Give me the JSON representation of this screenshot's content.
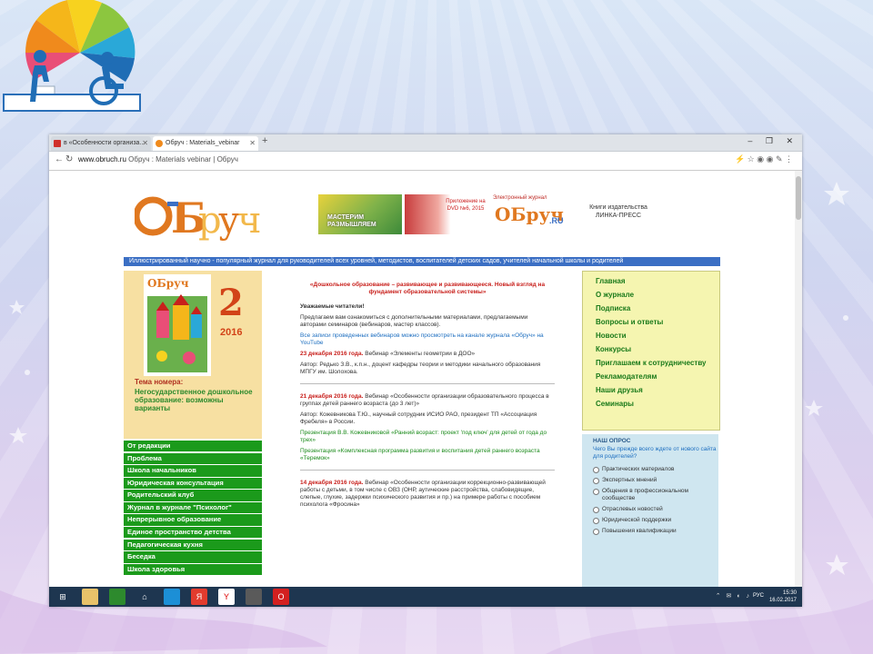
{
  "browser": {
    "tabs": [
      {
        "label": "в «Особенности организа...",
        "favicon": "red-b-icon"
      },
      {
        "label": "Обруч : Materials_vebinar",
        "favicon": "obruch-icon"
      }
    ],
    "new_tab": "+",
    "window_controls": "– ❐ ✕",
    "url_domain": "www.obruch.ru",
    "url_rest": " Обруч : Materials vebinar | Обруч"
  },
  "site": {
    "logo_text": "ОБруч",
    "banners": {
      "b1": "МАСТЕРИМ РАЗМЫШЛЯЕМ",
      "b2": "Приложение на DVD №6, 2015",
      "b3_top": "Электронный журнал",
      "b3_big": "ОБруч",
      "b3_ru": ".RU",
      "b4": "Книги издательства ЛИНКА-ПРЕСС"
    },
    "strip": "Иллюстрированный научно - популярный журнал для руководителей всех уровней, методистов, воспитателей детских садов, учителей начальной школы и родителей"
  },
  "cover": {
    "number": "2",
    "year": "2016",
    "theme_label": "Тема номера:",
    "theme_title": "Негосударственное дошкольное образование: возможны варианты"
  },
  "left_menu": [
    "От редакции",
    "Проблема",
    "Школа начальников",
    "Юридическая консультация",
    "Родительский клуб",
    "Журнал в журнале \"Психолог\"",
    "Непрерывное образование",
    "Единое пространство детства",
    "Педагогическая кухня",
    "Беседка",
    "Школа здоровья"
  ],
  "article": {
    "headline": "«Дошкольное образование – развивающее и развивающееся. Новый взгляд на фундамент образовательной системы»",
    "greeting": "Уважаемые читатели!",
    "intro": "Предлагаем вам ознакомиться с дополнительными материалами, предлагаемыми авторами семинаров (вебинаров, мастер классов).",
    "records_note": "Все записи проведенных вебинаров можно просмотреть на канале журнала «Обруч» на YouTube",
    "e1_date": "23 декабря 2016 года.",
    "e1_title": " Вебинар «Элементы геометрии в ДОО»",
    "e1_author": "Автор: Редько З.В., к.п.н., доцент кафедры теории и методики начального образования МПГУ им. Шолохова.",
    "e2_date": "21 декабря 2016 года.",
    "e2_title": " Вебинар «Особенности организации образовательного процесса в группах детей раннего возраста (до 3 лет)»",
    "e2_author": "Автор: Кожевникова Т.Ю., научный сотрудник ИСИО РАО, президент ТП «Ассоциация Фребеля» в России.",
    "e2_p1": "Презентация В.В. Кожевниковой «Ранний возраст: проект 'под ключ' для детей от года до трех»",
    "e2_p2": "Презентация «Комплексная программа развития и воспитания детей раннего возраста «Теремок»",
    "e3_date": "14 декабря 2016 года.",
    "e3_title": " Вебинар «Особенности организации коррекционно-развивающей работы с детьми, в том числе с ОВЗ (ОНР, аутические расстройства, слабовидящие, слепые, глухие, задержки психического развития и пр.) на примере работы с пособием психолога «Фросина»"
  },
  "right_menu": [
    "Главная",
    "О журнале",
    "Подписка",
    "Вопросы и ответы",
    "Новости",
    "Конкурсы",
    "Приглашаем к сотрудничеству",
    "Рекламодателям",
    "Наши друзья",
    "Семинары"
  ],
  "poll": {
    "header": "НАШ ОПРОС",
    "question": "Чего Вы прежде всего ждете от нового сайта для родителей?",
    "options": [
      "Практических материалов",
      "Экспертных мнений",
      "Общения в профессиональном сообществе",
      "Отраслевых новостей",
      "Юридической поддержки",
      "Повышения квалификации"
    ]
  },
  "taskbar": {
    "time": "15:30",
    "date": "16.02.2017",
    "lang": "РУС"
  },
  "colors": {
    "green_menu": "#1b9a1b",
    "blue_strip": "#3b6fc4",
    "red_text": "#c8201c",
    "taskbar": "#1e3650"
  }
}
